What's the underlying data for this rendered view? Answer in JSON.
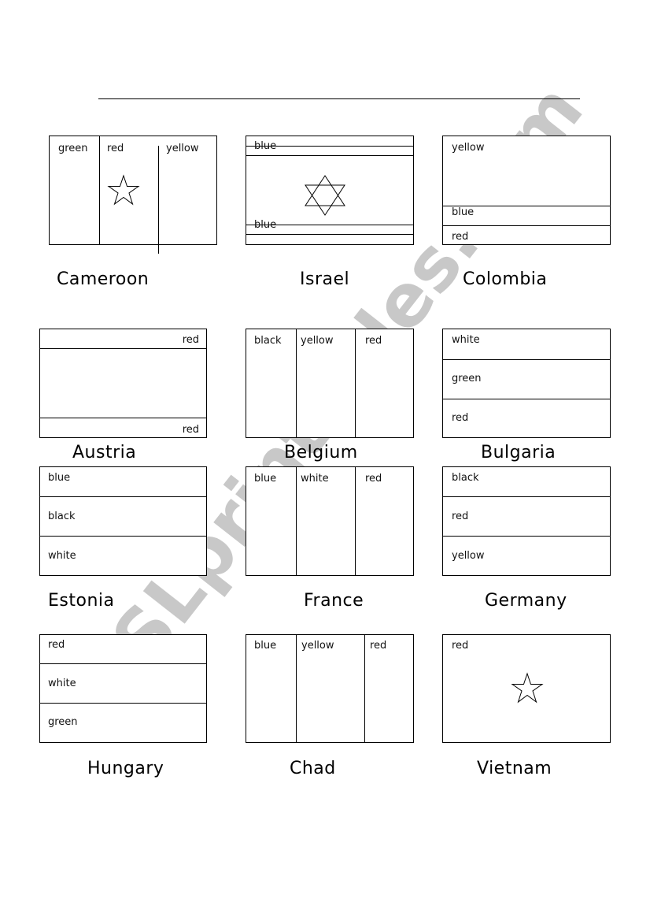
{
  "worksheet": {
    "name_line": "",
    "watermark": "ESLprintables.com",
    "watermark_color": "#c8c8c8",
    "flags": [
      {
        "country": "Cameroon",
        "layout": "vertical",
        "stripes": [
          "green",
          "red",
          "yellow"
        ],
        "emblem": "star"
      },
      {
        "country": "Israel",
        "layout": "israel",
        "stripes": [
          "blue",
          "blue"
        ],
        "emblem": "star-of-david"
      },
      {
        "country": "Colombia",
        "layout": "horizontal",
        "stripes": [
          "yellow",
          "blue",
          "red"
        ]
      },
      {
        "country": "Austria",
        "layout": "horizontal",
        "stripes": [
          "red",
          "",
          "red"
        ]
      },
      {
        "country": "Belgium",
        "layout": "vertical",
        "stripes": [
          "black",
          "yellow",
          "red"
        ]
      },
      {
        "country": "Bulgaria",
        "layout": "horizontal",
        "stripes": [
          "white",
          "green",
          "red"
        ]
      },
      {
        "country": "Estonia",
        "layout": "horizontal",
        "stripes": [
          "blue",
          "black",
          "white"
        ]
      },
      {
        "country": "France",
        "layout": "vertical",
        "stripes": [
          "blue",
          "white",
          "red"
        ]
      },
      {
        "country": "Germany",
        "layout": "horizontal",
        "stripes": [
          "black",
          "red",
          "yellow"
        ]
      },
      {
        "country": "Hungary",
        "layout": "horizontal",
        "stripes": [
          "red",
          "white",
          "green"
        ]
      },
      {
        "country": "Chad",
        "layout": "vertical",
        "stripes": [
          "blue",
          "yellow",
          "red"
        ]
      },
      {
        "country": "Vietnam",
        "layout": "plain",
        "stripes": [
          "red"
        ],
        "emblem": "star"
      }
    ]
  }
}
